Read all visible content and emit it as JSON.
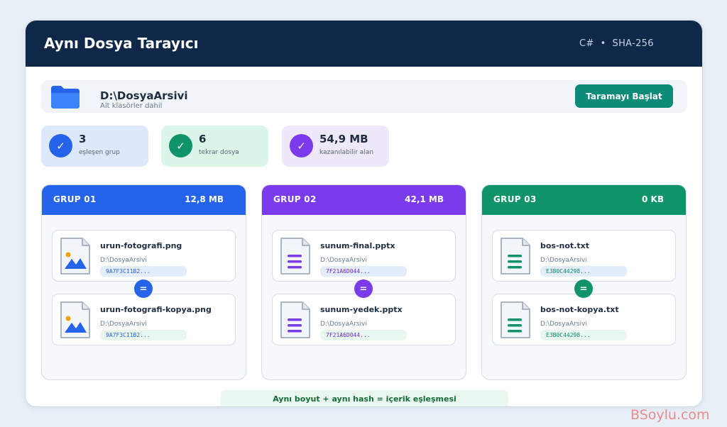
{
  "app": {
    "title": "Aynı Dosya Tarayıcı",
    "tech_lang": "C#",
    "tech_sep": "•",
    "tech_hash": "SHA-256"
  },
  "path_panel": {
    "folder_icon": "folder-icon",
    "path": "D:\\DosyaArsivi",
    "subtitle": "Alt klasörler dahil",
    "scan_button": "Taramayı Başlat"
  },
  "stats": [
    {
      "value": "3",
      "label": "eşleşen grup",
      "color": "#2563eb",
      "bg": "#dde9fb"
    },
    {
      "value": "6",
      "label": "tekrar dosya",
      "color": "#0e9468",
      "bg": "#dbf5e8"
    },
    {
      "value": "54,9 MB",
      "label": "kazanılabilir alan",
      "color": "#7c3aed",
      "bg": "#ede8fb"
    }
  ],
  "groups": [
    {
      "name": "GRUP 01",
      "size": "12,8 MB",
      "color": "#2563eb",
      "hash_bg": "#e3edfb",
      "hash_color": "#2563eb",
      "icon": "image-file-icon",
      "files": [
        {
          "name": "urun-fotografi.png",
          "path": "D:\\DosyaArsivi",
          "hash": "9A7F3C11B2..."
        },
        {
          "name": "urun-fotografi-kopya.png",
          "path": "D:\\DosyaArsivi",
          "hash": "9A7F3C11B2..."
        }
      ]
    },
    {
      "name": "GRUP 02",
      "size": "42,1 MB",
      "color": "#7c3aed",
      "hash_bg": "#e3edfb",
      "hash_color": "#6d28d9",
      "icon": "document-file-icon",
      "files": [
        {
          "name": "sunum-final.pptx",
          "path": "D:\\DosyaArsivi",
          "hash": "7F21A6D044..."
        },
        {
          "name": "sunum-yedek.pptx",
          "path": "D:\\DosyaArsivi",
          "hash": "7F21A6D044..."
        }
      ]
    },
    {
      "name": "GRUP 03",
      "size": "0 KB",
      "color": "#0e9468",
      "hash_bg": "#e3edfb",
      "hash_color": "#0e8a6a",
      "icon": "text-file-icon",
      "files": [
        {
          "name": "bos-not.txt",
          "path": "D:\\DosyaArsivi",
          "hash": "E3B0C44298..."
        },
        {
          "name": "bos-not-kopya.txt",
          "path": "D:\\DosyaArsivi",
          "hash": "E3B0C44298..."
        }
      ]
    }
  ],
  "equal_sign": "=",
  "check_mark": "✓",
  "footnote": "Aynı boyut + aynı hash = içerik eşleşmesi",
  "watermark": "BSoylu.com"
}
